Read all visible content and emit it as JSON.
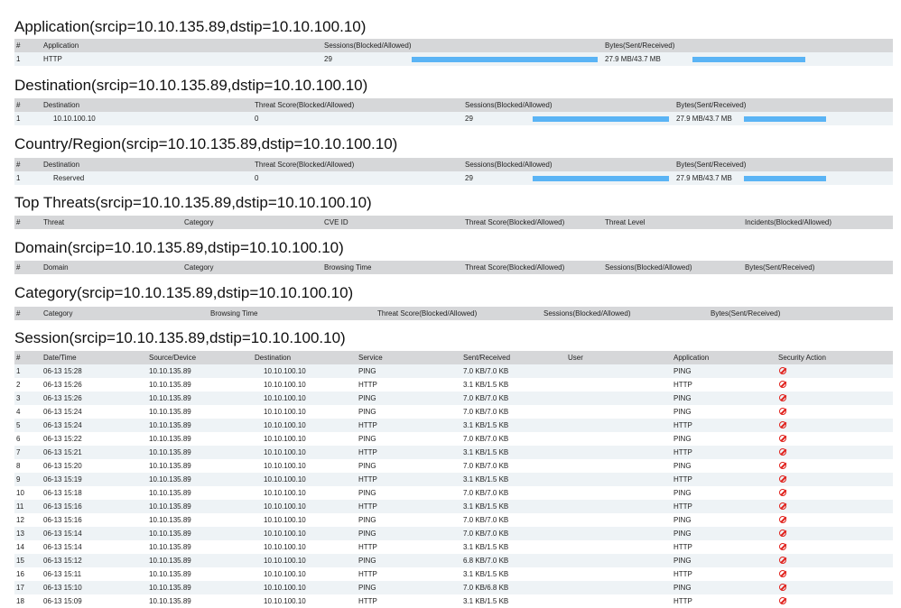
{
  "application": {
    "title": "Application(srcip=10.10.135.89,dstip=10.10.100.10)",
    "headers": [
      "#",
      "Application",
      "Sessions(Blocked/Allowed)",
      "Bytes(Sent/Received)"
    ],
    "rows": [
      {
        "num": "1",
        "name": "HTTP",
        "sessions": "29",
        "sessions_bar": 1.0,
        "bytes": "27.9 MB/43.7 MB",
        "bytes_bar": 1.0
      }
    ]
  },
  "destination": {
    "title": "Destination(srcip=10.10.135.89,dstip=10.10.100.10)",
    "headers": [
      "#",
      "Destination",
      "Threat Score(Blocked/Allowed)",
      "Sessions(Blocked/Allowed)",
      "Bytes(Sent/Received)"
    ],
    "rows": [
      {
        "num": "1",
        "name": "10.10.100.10",
        "threat": "0",
        "sessions": "29",
        "sessions_bar": 1.0,
        "bytes": "27.9 MB/43.7 MB",
        "bytes_bar": 1.0
      }
    ]
  },
  "country": {
    "title": "Country/Region(srcip=10.10.135.89,dstip=10.10.100.10)",
    "headers": [
      "#",
      "Destination",
      "Threat Score(Blocked/Allowed)",
      "Sessions(Blocked/Allowed)",
      "Bytes(Sent/Received)"
    ],
    "rows": [
      {
        "num": "1",
        "name": "Reserved",
        "threat": "0",
        "sessions": "29",
        "sessions_bar": 1.0,
        "bytes": "27.9 MB/43.7 MB",
        "bytes_bar": 1.0
      }
    ]
  },
  "threats": {
    "title": "Top Threats(srcip=10.10.135.89,dstip=10.10.100.10)",
    "headers": [
      "#",
      "Threat",
      "Category",
      "CVE ID",
      "Threat Score(Blocked/Allowed)",
      "Threat Level",
      "Incidents(Blocked/Allowed)"
    ]
  },
  "domain": {
    "title": "Domain(srcip=10.10.135.89,dstip=10.10.100.10)",
    "headers": [
      "#",
      "Domain",
      "Category",
      "Browsing Time",
      "Threat Score(Blocked/Allowed)",
      "Sessions(Blocked/Allowed)",
      "Bytes(Sent/Received)"
    ]
  },
  "category": {
    "title": "Category(srcip=10.10.135.89,dstip=10.10.100.10)",
    "headers": [
      "#",
      "Category",
      "Browsing Time",
      "Threat Score(Blocked/Allowed)",
      "Sessions(Blocked/Allowed)",
      "Bytes(Sent/Received)"
    ]
  },
  "session": {
    "title": "Session(srcip=10.10.135.89,dstip=10.10.100.10)",
    "headers": [
      "#",
      "Date/Time",
      "Source/Device",
      "Destination",
      "Service",
      "Sent/Received",
      "User",
      "Application",
      "Security Action"
    ],
    "action_icon": "blocked-icon",
    "rows": [
      [
        "1",
        "06-13 15:28",
        "10.10.135.89",
        "10.10.100.10",
        "PING",
        "7.0 KB/7.0 KB",
        "",
        "PING"
      ],
      [
        "2",
        "06-13 15:26",
        "10.10.135.89",
        "10.10.100.10",
        "HTTP",
        "3.1 KB/1.5 KB",
        "",
        "HTTP"
      ],
      [
        "3",
        "06-13 15:26",
        "10.10.135.89",
        "10.10.100.10",
        "PING",
        "7.0 KB/7.0 KB",
        "",
        "PING"
      ],
      [
        "4",
        "06-13 15:24",
        "10.10.135.89",
        "10.10.100.10",
        "PING",
        "7.0 KB/7.0 KB",
        "",
        "PING"
      ],
      [
        "5",
        "06-13 15:24",
        "10.10.135.89",
        "10.10.100.10",
        "HTTP",
        "3.1 KB/1.5 KB",
        "",
        "HTTP"
      ],
      [
        "6",
        "06-13 15:22",
        "10.10.135.89",
        "10.10.100.10",
        "PING",
        "7.0 KB/7.0 KB",
        "",
        "PING"
      ],
      [
        "7",
        "06-13 15:21",
        "10.10.135.89",
        "10.10.100.10",
        "HTTP",
        "3.1 KB/1.5 KB",
        "",
        "HTTP"
      ],
      [
        "8",
        "06-13 15:20",
        "10.10.135.89",
        "10.10.100.10",
        "PING",
        "7.0 KB/7.0 KB",
        "",
        "PING"
      ],
      [
        "9",
        "06-13 15:19",
        "10.10.135.89",
        "10.10.100.10",
        "HTTP",
        "3.1 KB/1.5 KB",
        "",
        "HTTP"
      ],
      [
        "10",
        "06-13 15:18",
        "10.10.135.89",
        "10.10.100.10",
        "PING",
        "7.0 KB/7.0 KB",
        "",
        "PING"
      ],
      [
        "11",
        "06-13 15:16",
        "10.10.135.89",
        "10.10.100.10",
        "HTTP",
        "3.1 KB/1.5 KB",
        "",
        "HTTP"
      ],
      [
        "12",
        "06-13 15:16",
        "10.10.135.89",
        "10.10.100.10",
        "PING",
        "7.0 KB/7.0 KB",
        "",
        "PING"
      ],
      [
        "13",
        "06-13 15:14",
        "10.10.135.89",
        "10.10.100.10",
        "PING",
        "7.0 KB/7.0 KB",
        "",
        "PING"
      ],
      [
        "14",
        "06-13 15:14",
        "10.10.135.89",
        "10.10.100.10",
        "HTTP",
        "3.1 KB/1.5 KB",
        "",
        "HTTP"
      ],
      [
        "15",
        "06-13 15:12",
        "10.10.135.89",
        "10.10.100.10",
        "PING",
        "6.8 KB/7.0 KB",
        "",
        "PING"
      ],
      [
        "16",
        "06-13 15:11",
        "10.10.135.89",
        "10.10.100.10",
        "HTTP",
        "3.1 KB/1.5 KB",
        "",
        "HTTP"
      ],
      [
        "17",
        "06-13 15:10",
        "10.10.135.89",
        "10.10.100.10",
        "PING",
        "7.0 KB/6.8 KB",
        "",
        "PING"
      ],
      [
        "18",
        "06-13 15:09",
        "10.10.135.89",
        "10.10.100.10",
        "HTTP",
        "3.1 KB/1.5 KB",
        "",
        "HTTP"
      ]
    ]
  }
}
